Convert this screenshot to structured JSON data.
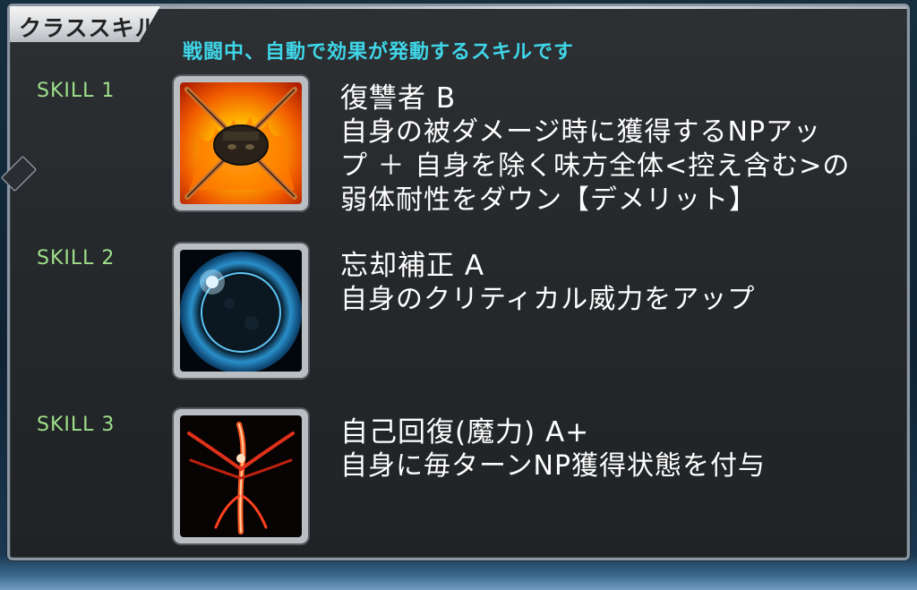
{
  "panel": {
    "title": "クラススキル",
    "subtitle": "戦闘中、自動で効果が発動するスキルです"
  },
  "skills": [
    {
      "label": "SKILL 1",
      "name": "復讐者 B",
      "description_lines": [
        "自身の被ダメージ時に獲得するNPアッ",
        "プ ＋ 自身を除く味方全体<控え含む>の",
        "弱体耐性をダウン【デメリット】"
      ],
      "icon": "avenger-chains-fire-icon"
    },
    {
      "label": "SKILL 2",
      "name": "忘却補正 A",
      "description_lines": [
        "自身のクリティカル威力をアップ"
      ],
      "icon": "eclipse-icon"
    },
    {
      "label": "SKILL 3",
      "name": "自己回復(魔力) A+",
      "description_lines": [
        "自身に毎ターンNP獲得状態を付与"
      ],
      "icon": "red-flame-wings-icon"
    }
  ],
  "colors": {
    "subtitle": "#3fd6e8",
    "skill_label": "#9fe08a",
    "text": "#ffffff",
    "panel_bg": "#26292c"
  }
}
